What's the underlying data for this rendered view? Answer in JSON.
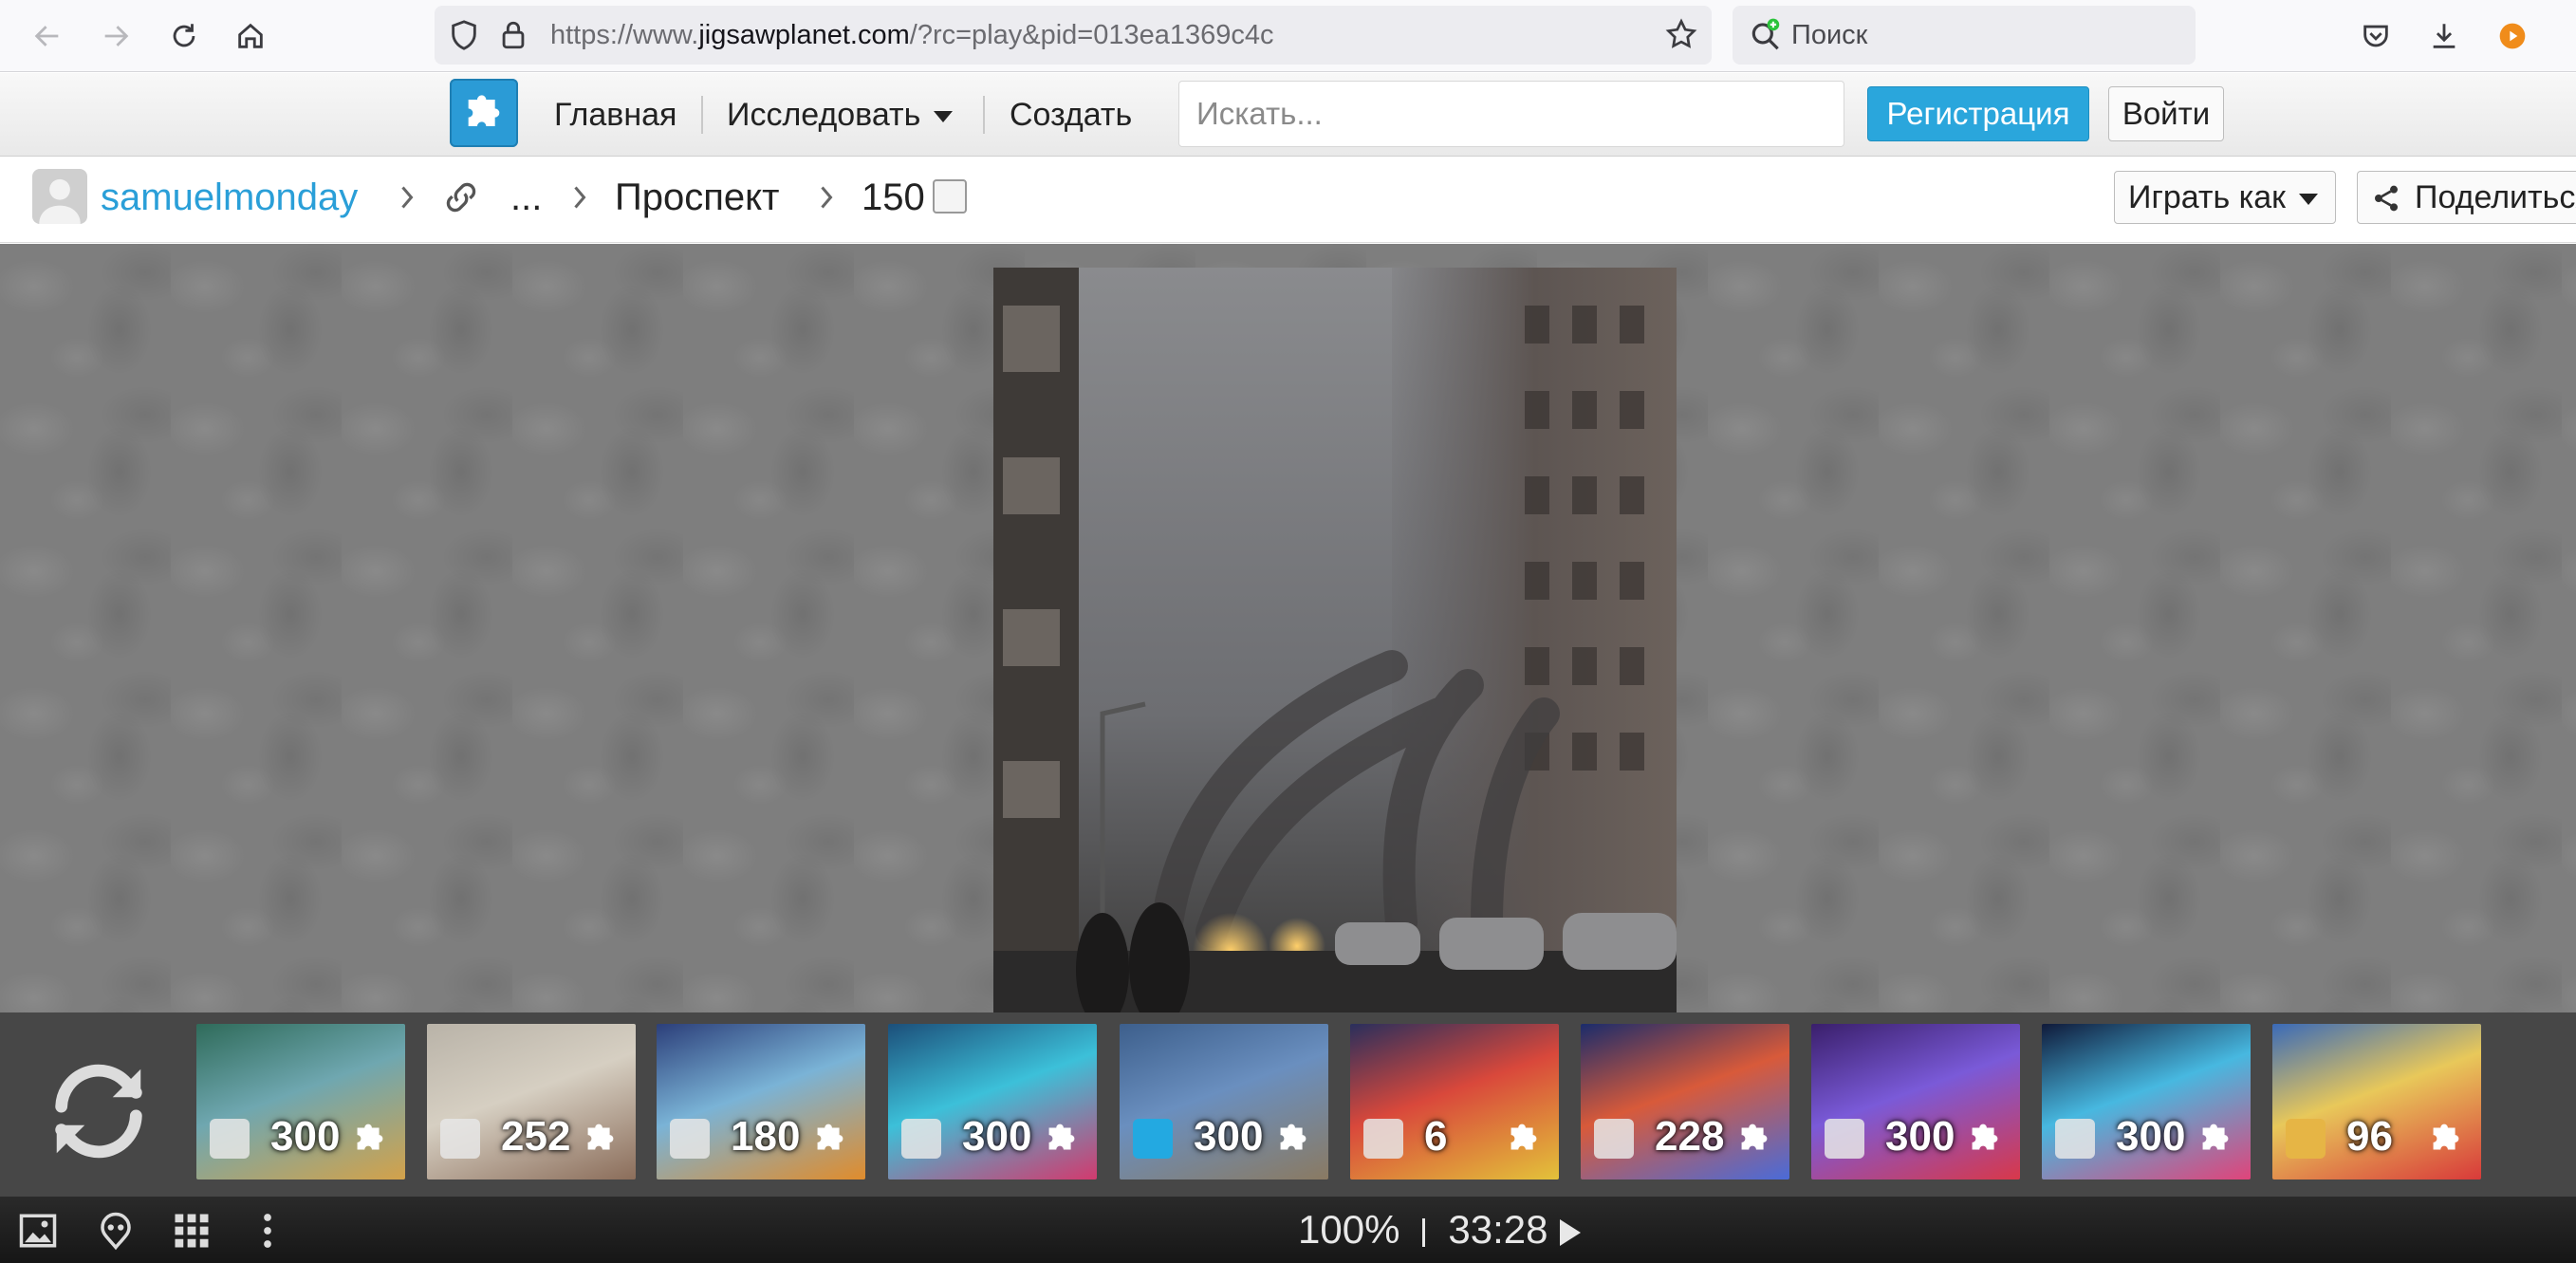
{
  "browser": {
    "url_prefix": "https://www.",
    "url_host": "jigsawplanet.com",
    "url_rest": "/?rc=play&pid=013ea1369c4c",
    "search_placeholder": "Поиск",
    "icons": [
      "back-icon",
      "forward-icon",
      "reload-icon",
      "home-icon",
      "shield-icon",
      "lock-icon",
      "bookmark-star-icon",
      "search-icon",
      "pocket-icon",
      "download-icon",
      "extension-icon"
    ]
  },
  "site": {
    "nav": {
      "home": "Главная",
      "explore": "Исследовать",
      "create": "Создать"
    },
    "search_placeholder": "Искать...",
    "register": "Регистрация",
    "login": "Войти",
    "accent_color": "#2aa6dc"
  },
  "breadcrumb": {
    "user": "samuelmonday",
    "ellipsis": "...",
    "category": "Проспект",
    "pieces": "150"
  },
  "actions": {
    "play_as": "Играть как",
    "share": "Поделиться"
  },
  "thumbnails": [
    {
      "count": "300",
      "owner": "light"
    },
    {
      "count": "252",
      "owner": "light"
    },
    {
      "count": "180",
      "owner": "light"
    },
    {
      "count": "300",
      "owner": "light"
    },
    {
      "count": "300",
      "owner": "cyan"
    },
    {
      "count": "6",
      "owner": "light"
    },
    {
      "count": "228",
      "owner": "light"
    },
    {
      "count": "300",
      "owner": "light"
    },
    {
      "count": "300",
      "owner": "light"
    },
    {
      "count": "96",
      "owner": "gold"
    }
  ],
  "status": {
    "zoom": "100%",
    "time": "33:28"
  }
}
